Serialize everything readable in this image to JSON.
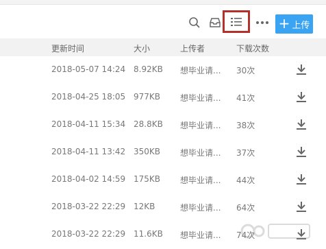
{
  "toolbar": {
    "icons": [
      "search-icon",
      "inbox-icon",
      "list-view-icon",
      "more-icon"
    ],
    "upload_label": "上传",
    "accent": "#3aa3f2",
    "highlight": "#b5302a"
  },
  "table": {
    "headers": {
      "time": "更新时间",
      "size": "大小",
      "uploader": "上传者",
      "downloads": "下载次数"
    },
    "rows": [
      {
        "time": "2018-05-07 14:24",
        "size": "8.92KB",
        "uploader": "想毕业请...",
        "downloads": "30次"
      },
      {
        "time": "2018-04-25 18:05",
        "size": "977KB",
        "uploader": "想毕业请...",
        "downloads": "41次"
      },
      {
        "time": "2018-04-11 15:34",
        "size": "28.8KB",
        "uploader": "想毕业请...",
        "downloads": "38次"
      },
      {
        "time": "2018-04-11 13:42",
        "size": "350KB",
        "uploader": "想毕业请...",
        "downloads": "37次"
      },
      {
        "time": "2018-04-02 14:59",
        "size": "175KB",
        "uploader": "想毕业请...",
        "downloads": "44次"
      },
      {
        "time": "2018-03-22 22:29",
        "size": "12KB",
        "uploader": "想毕业请...",
        "downloads": "64次"
      },
      {
        "time": "2018-03-22 22:29",
        "size": "11.6KB",
        "uploader": "想毕业请...",
        "downloads": "74次"
      }
    ]
  }
}
